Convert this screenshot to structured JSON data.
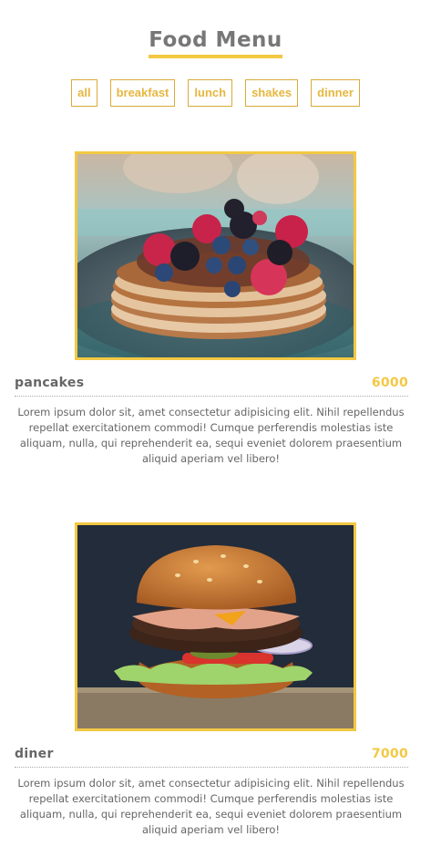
{
  "header": {
    "title": "Food Menu"
  },
  "filters": [
    "all",
    "breakfast",
    "lunch",
    "shakes",
    "dinner"
  ],
  "colors": {
    "accent": "#f3c843",
    "text": "#666666"
  },
  "items": [
    {
      "name": "pancakes",
      "price": "6000",
      "image_icon": "pancakes-photo",
      "description": "Lorem ipsum dolor sit, amet consectetur adipisicing elit. Nihil repellendus repellat exercitationem commodi! Cumque perferendis molestias iste aliquam, nulla, qui reprehenderit ea, sequi eveniet dolorem praesentium aliquid aperiam vel libero!"
    },
    {
      "name": "diner",
      "price": "7000",
      "image_icon": "burger-photo",
      "description": "Lorem ipsum dolor sit, amet consectetur adipisicing elit. Nihil repellendus repellat exercitationem commodi! Cumque perferendis molestias iste aliquam, nulla, qui reprehenderit ea, sequi eveniet dolorem praesentium aliquid aperiam vel libero!"
    }
  ]
}
